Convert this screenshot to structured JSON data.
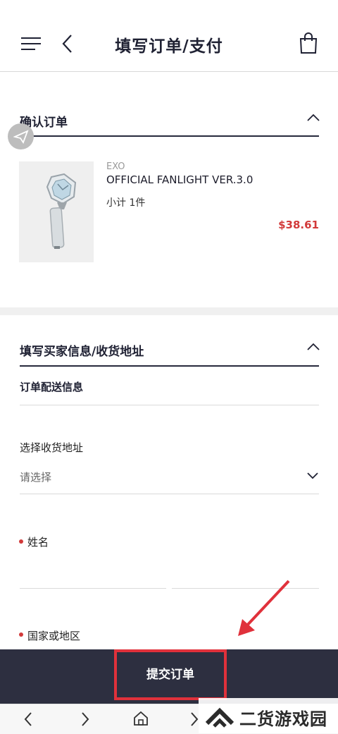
{
  "header": {
    "title": "填写订单/支付",
    "menu_icon": "menu-icon",
    "back_icon": "chevron-left-icon",
    "cart_icon": "shopping-bag-icon"
  },
  "confirm_section": {
    "title": "确认订单",
    "collapse_icon": "chevron-up-icon",
    "item": {
      "brand": "EXO",
      "name": "OFFICIAL FANLIGHT VER.3.0",
      "qty": "小计 1件",
      "price": "$38.61",
      "price_color": "#d23a3a",
      "image": "fanlight-product-image"
    }
  },
  "buyer_section": {
    "title": "填写买家信息/收货地址",
    "collapse_icon": "chevron-up-icon",
    "delivery_info": "订单配送信息",
    "address_label": "选择收货地址",
    "address_select": "请选择",
    "name_label": "姓名",
    "country_label": "国家或地区"
  },
  "submit": {
    "label": "提交订单"
  },
  "bottom_nav": {
    "back_icon": "chevron-left-icon",
    "forward_icon": "chevron-right-icon",
    "home_icon": "home-icon"
  },
  "watermark": {
    "text": "二货游戏园"
  },
  "colors": {
    "accent": "#2d2f40",
    "highlight": "#e0313b",
    "arrow": "#e0313b"
  }
}
